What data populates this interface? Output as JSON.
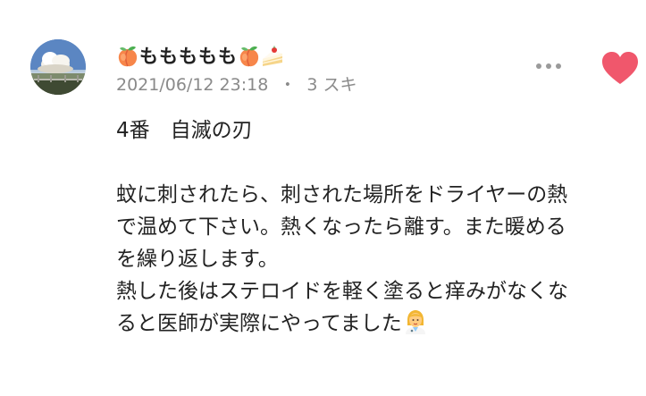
{
  "comment": {
    "author": {
      "name": "ももももも",
      "name_prefix_emoji": "peach-icon",
      "name_suffix_emojis": [
        "peach-icon",
        "shortcake-icon"
      ]
    },
    "date": "2021/06/12 23:18",
    "separator": "・",
    "likes": "3 スキ",
    "more_icon": "more-horizontal-icon",
    "like_icon": "heart-icon",
    "like_color": "#f0576c",
    "body_lines": [
      "4番　自滅の刃",
      "",
      "蚊に刺されたら、刺された場所をドライヤーの熱",
      "で温めて下さい。熱くなったら離す。また暖める",
      "を繰り返します。",
      "熱した後はステロイドを軽く塗ると痒みがなくな",
      "ると医師が実際にやってました"
    ],
    "body_end_emoji": "woman-health-worker-icon"
  }
}
